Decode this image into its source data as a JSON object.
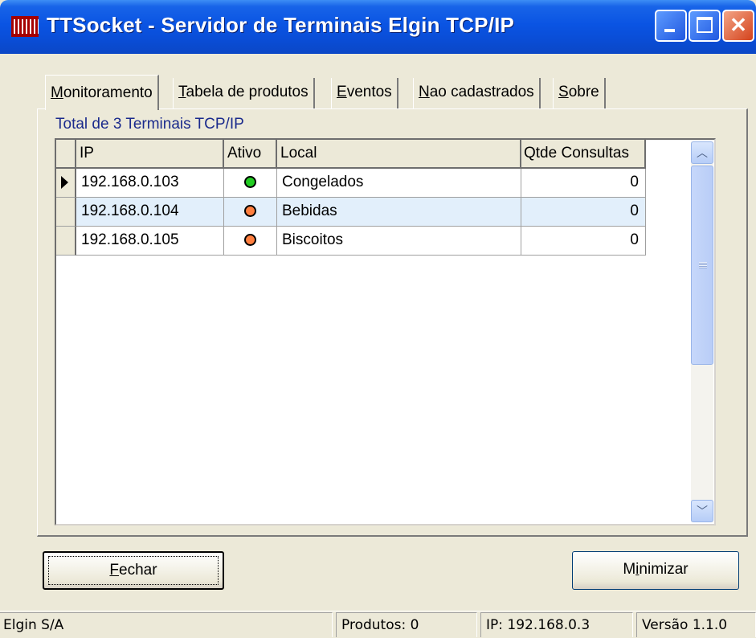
{
  "window": {
    "title": "TTSocket  - Servidor de Terminais Elgin TCP/IP",
    "icon": "barcode-icon"
  },
  "tabs": [
    {
      "label_first": "M",
      "label_rest": "onitoramento",
      "active": true
    },
    {
      "label_first": "T",
      "label_rest": "abela de produtos",
      "active": false
    },
    {
      "label_first": "E",
      "label_rest": "ventos",
      "active": false
    },
    {
      "label_first": "N",
      "label_rest": "ao cadastrados",
      "active": false
    },
    {
      "label_first": "S",
      "label_rest": "obre",
      "active": false
    }
  ],
  "monitor": {
    "total_label": "Total de 3 Terminais TCP/IP",
    "columns": [
      "IP",
      "Ativo",
      "Local",
      "Qtde Consultas"
    ],
    "rows": [
      {
        "ip": "192.168.0.103",
        "status_color": "#22cc22",
        "local": "Congelados",
        "queries": "0",
        "current": true
      },
      {
        "ip": "192.168.0.104",
        "status_color": "#ff7f3f",
        "local": "Bebidas",
        "queries": "0",
        "current": false
      },
      {
        "ip": "192.168.0.105",
        "status_color": "#ff7f3f",
        "local": "Biscoitos",
        "queries": "0",
        "current": false
      }
    ]
  },
  "buttons": {
    "close_first": "F",
    "close_rest": "echar",
    "minimize_pre": "M",
    "minimize_underlined": "i",
    "minimize_post": "nimizar"
  },
  "statusbar": {
    "company": "Elgin S/A",
    "products": "Produtos: 0",
    "ip": "IP: 192.168.0.3",
    "version": "Versão 1.1.0"
  }
}
